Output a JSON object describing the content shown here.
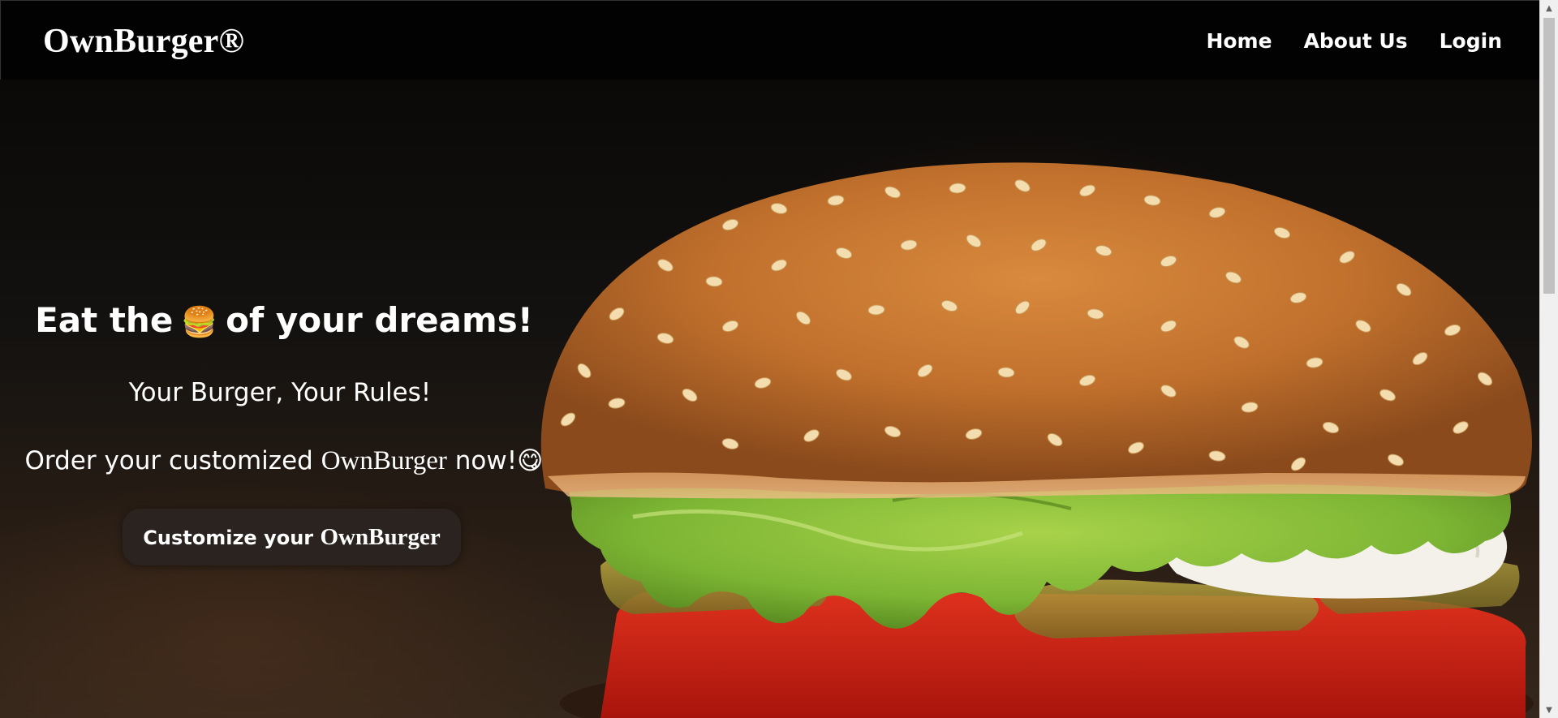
{
  "navbar": {
    "brand": "OwnBurger®",
    "links": [
      {
        "label": "Home"
      },
      {
        "label": "About Us"
      },
      {
        "label": "Login"
      }
    ]
  },
  "hero": {
    "headline_before": "Eat the",
    "headline_emoji": "🍔",
    "headline_after": "of your dreams!",
    "subline": "Your Burger, Your Rules!",
    "order_before": "Order your customized ",
    "order_brand": "OwnBurger",
    "order_after": " now!",
    "order_emoji": "😋",
    "cta_before": "Customize your ",
    "cta_brand": "OwnBurger"
  },
  "colors": {
    "navbar_bg": "#020202",
    "text": "#ffffff",
    "cta_bg": "#2a2320"
  },
  "icons": {
    "scroll_up": "triangle-up",
    "scroll_down": "triangle-down"
  }
}
